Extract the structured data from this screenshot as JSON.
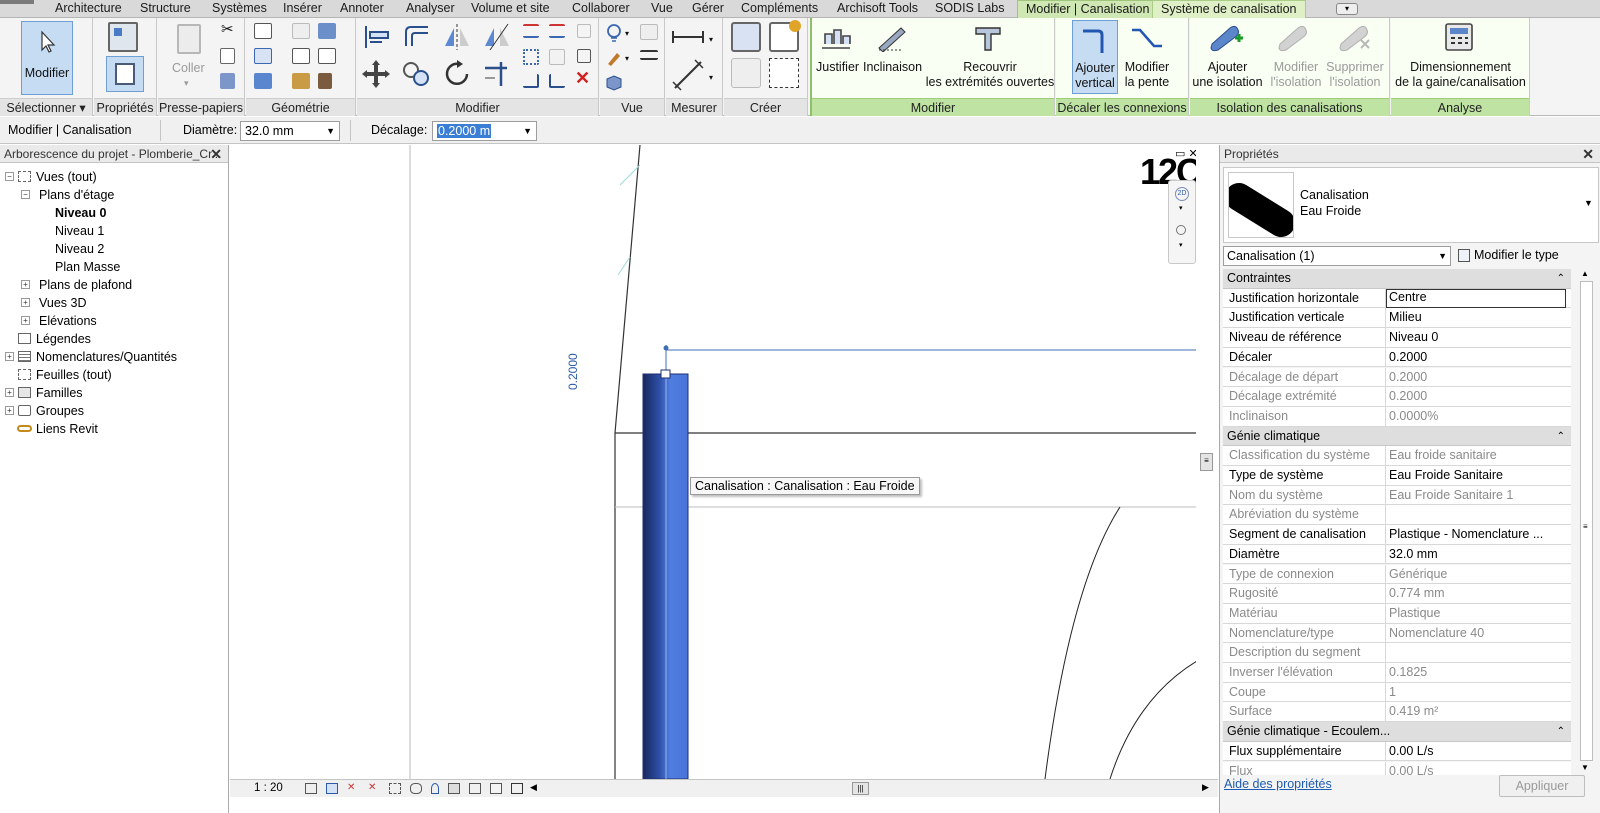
{
  "tabs": [
    "Architecture",
    "Structure",
    "Systèmes",
    "Insérer",
    "Annoter",
    "Analyser",
    "Volume et site",
    "Collaborer",
    "Vue",
    "Gérer",
    "Compléments",
    "Archisoft Tools",
    "SODIS Labs",
    "Modifier | Canalisation",
    "Système de canalisation"
  ],
  "ribbon": {
    "modifier_label": "Modifier",
    "coller_label": "Coller",
    "panels": {
      "selectionner": "Sélectionner",
      "proprietes": "Propriétés",
      "presse_papiers": "Presse-papiers",
      "geometrie": "Géométrie",
      "modifier": "Modifier",
      "vue": "Vue",
      "mesurer": "Mesurer",
      "creer": "Créer",
      "modifier2": "Modifier",
      "decaler": "Décaler les connexions",
      "isolation": "Isolation des canalisations",
      "analyse": "Analyse"
    },
    "justifier": "Justifier",
    "inclinaison": "Inclinaison",
    "recouvrir_1": "Recouvrir",
    "recouvrir_2": "les extrémités ouvertes",
    "ajouter_vertical_1": "Ajouter",
    "ajouter_vertical_2": "vertical",
    "modifier_pente_1": "Modifier",
    "modifier_pente_2": "la pente",
    "ajouter_isolation_1": "Ajouter",
    "ajouter_isolation_2": "une isolation",
    "modifier_isolation_1": "Modifier",
    "modifier_isolation_2": "l'isolation",
    "supprimer_isolation_1": "Supprimer",
    "supprimer_isolation_2": "l'isolation",
    "dimensionnement_1": "Dimensionnement",
    "dimensionnement_2": "de la gaine/canalisation"
  },
  "optbar": {
    "context": "Modifier | Canalisation",
    "diametre_label": "Diamètre:",
    "diametre_value": "32.0 mm",
    "decalage_label": "Décalage:",
    "decalage_value": "0.2000 m"
  },
  "browser": {
    "title": "Arborescence du projet - Plomberie_Cr...",
    "items": [
      {
        "label": "Vues (tout)"
      },
      {
        "label": "Plans d'étage"
      },
      {
        "label": "Niveau 0"
      },
      {
        "label": "Niveau 1"
      },
      {
        "label": "Niveau 2"
      },
      {
        "label": "Plan Masse"
      },
      {
        "label": "Plans de plafond"
      },
      {
        "label": "Vues 3D"
      },
      {
        "label": "Elévations"
      },
      {
        "label": "Légendes"
      },
      {
        "label": "Nomenclatures/Quantités"
      },
      {
        "label": "Feuilles (tout)"
      },
      {
        "label": "Familles"
      },
      {
        "label": "Groupes"
      },
      {
        "label": "Liens Revit"
      }
    ]
  },
  "canvas": {
    "dimension_text": "0.2000",
    "tooltip": "Canalisation : Canalisation : Eau Froide",
    "viewcube_text": "12C",
    "nav_2d": "2D",
    "scale": "1 : 20"
  },
  "colors": {
    "pipe": "#4a73d9",
    "pipe_dark": "#1e2f72",
    "selection_blue": "#3d6fb6",
    "context_green": "#bfe3a2"
  },
  "props": {
    "title": "Propriétés",
    "type_name_1": "Canalisation",
    "type_name_2": "Eau Froide",
    "selector": "Canalisation (1)",
    "edit_type": "Modifier le type",
    "help": "Aide des propriétés",
    "apply": "Appliquer",
    "rows": [
      {
        "group": "Contraintes"
      },
      {
        "k": "Justification horizontale",
        "v": "Centre",
        "ro": false
      },
      {
        "k": "Justification verticale",
        "v": "Milieu",
        "ro": false
      },
      {
        "k": "Niveau de référence",
        "v": "Niveau 0",
        "ro": false
      },
      {
        "k": "Décaler",
        "v": "0.2000",
        "ro": false
      },
      {
        "k": "Décalage de départ",
        "v": "0.2000",
        "ro": true
      },
      {
        "k": "Décalage extrémité",
        "v": "0.2000",
        "ro": true
      },
      {
        "k": "Inclinaison",
        "v": "0.0000%",
        "ro": true
      },
      {
        "group": "Génie climatique"
      },
      {
        "k": "Classification du système",
        "v": "Eau froide sanitaire",
        "ro": true
      },
      {
        "k": "Type de système",
        "v": "Eau Froide Sanitaire",
        "ro": false
      },
      {
        "k": "Nom du système",
        "v": "Eau Froide Sanitaire 1",
        "ro": true
      },
      {
        "k": "Abréviation du système",
        "v": "",
        "ro": true
      },
      {
        "k": "Segment de canalisation",
        "v": "Plastique - Nomenclature ...",
        "ro": false
      },
      {
        "k": "Diamètre",
        "v": "32.0 mm",
        "ro": false
      },
      {
        "k": "Type de connexion",
        "v": "Générique",
        "ro": true
      },
      {
        "k": "Rugosité",
        "v": "0.774 mm",
        "ro": true
      },
      {
        "k": "Matériau",
        "v": "Plastique",
        "ro": true
      },
      {
        "k": "Nomenclature/type",
        "v": "Nomenclature 40",
        "ro": true
      },
      {
        "k": "Description du segment",
        "v": "",
        "ro": true
      },
      {
        "k": "Inverser l'élévation",
        "v": "0.1825",
        "ro": true
      },
      {
        "k": "Coupe",
        "v": "1",
        "ro": true
      },
      {
        "k": "Surface",
        "v": "0.419 m²",
        "ro": true
      },
      {
        "group": "Génie climatique - Ecoulem..."
      },
      {
        "k": "Flux supplémentaire",
        "v": "0.00 L/s",
        "ro": false
      },
      {
        "k": "Flux",
        "v": "0.00 L/s",
        "ro": true
      }
    ]
  }
}
